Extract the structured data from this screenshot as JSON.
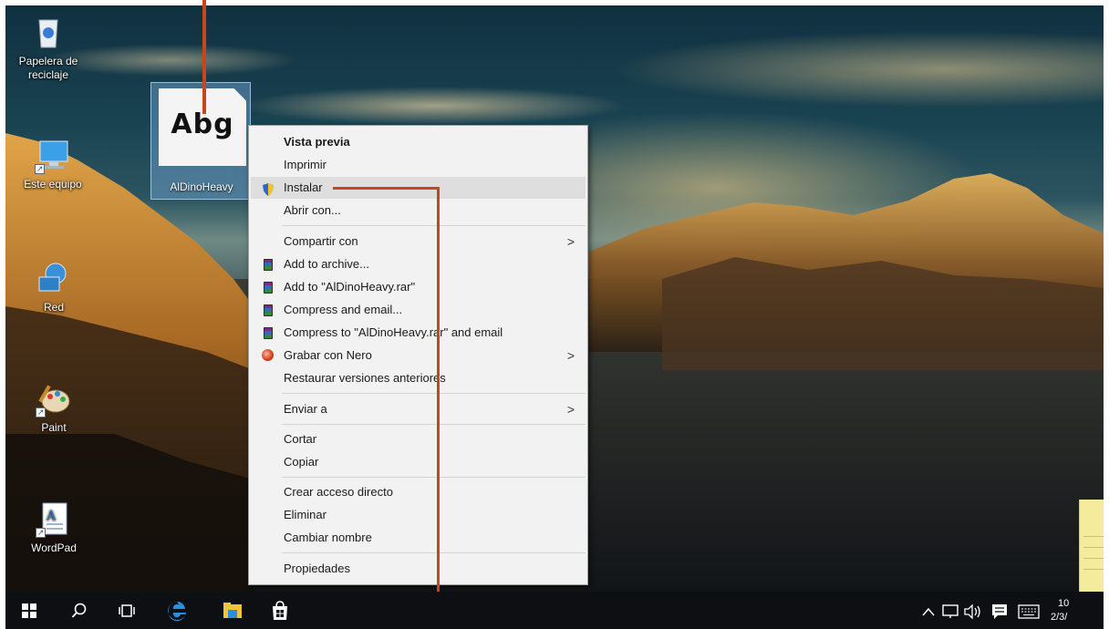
{
  "desktop": {
    "icons": [
      {
        "label": "Papelera de reciclaje",
        "icon": "recycle-bin-icon"
      },
      {
        "label": "Este equipo",
        "icon": "computer-icon"
      },
      {
        "label": "Red",
        "icon": "network-icon"
      },
      {
        "label": "Paint",
        "icon": "paint-icon"
      },
      {
        "label": "WordPad",
        "icon": "wordpad-icon"
      }
    ],
    "selected_file": {
      "label": "AlDinoHeavy",
      "preview_text": "Abg",
      "icon": "font-file-icon"
    }
  },
  "context_menu": {
    "items": [
      {
        "label": "Vista previa",
        "bold": true
      },
      {
        "label": "Imprimir"
      },
      {
        "label": "Instalar",
        "icon": "uac-shield-icon",
        "highlighted": true
      },
      {
        "label": "Abrir con..."
      },
      {
        "label": "Compartir con",
        "submenu": true
      },
      {
        "label": "Add to archive...",
        "icon": "winrar-icon"
      },
      {
        "label": "Add to \"AlDinoHeavy.rar\"",
        "icon": "winrar-icon"
      },
      {
        "label": "Compress and email...",
        "icon": "winrar-icon"
      },
      {
        "label": "Compress to \"AlDinoHeavy.rar\" and email",
        "icon": "winrar-icon"
      },
      {
        "label": "Grabar con Nero",
        "icon": "nero-icon",
        "submenu": true
      },
      {
        "label": "Restaurar versiones anteriores"
      },
      {
        "label": "Enviar a",
        "submenu": true
      },
      {
        "label": "Cortar"
      },
      {
        "label": "Copiar"
      },
      {
        "label": "Crear acceso directo"
      },
      {
        "label": "Eliminar"
      },
      {
        "label": "Cambiar nombre"
      },
      {
        "label": "Propiedades"
      }
    ],
    "submenu_arrow": ">"
  },
  "taskbar": {
    "buttons": [
      {
        "icon": "windows-start-icon"
      },
      {
        "icon": "search-icon"
      },
      {
        "icon": "task-view-icon"
      },
      {
        "icon": "edge-browser-icon"
      },
      {
        "icon": "file-explorer-icon"
      },
      {
        "icon": "store-icon"
      }
    ],
    "tray": {
      "icons": [
        "chevron-up-icon",
        "network-status-icon",
        "volume-icon",
        "action-center-icon",
        "keyboard-icon"
      ],
      "time": "10",
      "date": "2/3/"
    }
  },
  "colors": {
    "callout": "#c8471a",
    "menu_background": "#f2f2f2",
    "menu_highlight": "#dedede",
    "taskbar": "#0d0f12"
  }
}
